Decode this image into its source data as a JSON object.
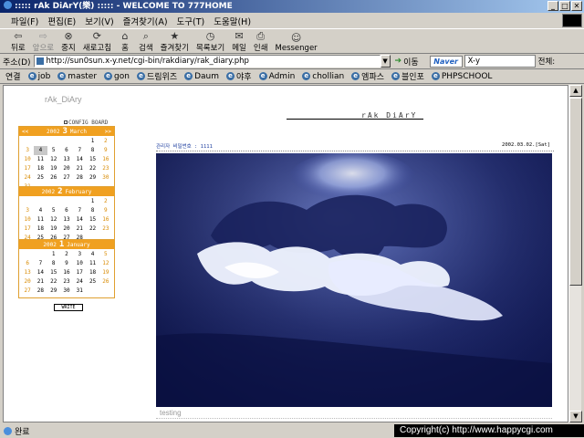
{
  "window": {
    "title": "::::: rAk DiArY(樂) ::::: - WELCOME TO 777HOME",
    "buttons": [
      "_",
      "□",
      "✕"
    ]
  },
  "menu": [
    "파일(F)",
    "편집(E)",
    "보기(V)",
    "즐겨찾기(A)",
    "도구(T)",
    "도움말(H)"
  ],
  "toolbar": [
    {
      "label": "뒤로",
      "icon": "back-arrow-icon",
      "glyph": "⇦",
      "disabled": false
    },
    {
      "label": "앞으로",
      "icon": "forward-arrow-icon",
      "glyph": "⇨",
      "disabled": true
    },
    {
      "label": "중지",
      "icon": "stop-icon",
      "glyph": "⊗",
      "disabled": false
    },
    {
      "label": "새로고침",
      "icon": "refresh-icon",
      "glyph": "⟳",
      "disabled": false
    },
    {
      "label": "홈",
      "icon": "home-icon",
      "glyph": "⌂",
      "disabled": false
    },
    {
      "label": "검색",
      "icon": "search-icon",
      "glyph": "⌕",
      "disabled": false
    },
    {
      "label": "즐겨찾기",
      "icon": "favorites-icon",
      "glyph": "★",
      "disabled": false
    },
    {
      "label": "목록보기",
      "icon": "history-icon",
      "glyph": "◷",
      "disabled": false
    },
    {
      "label": "메일",
      "icon": "mail-icon",
      "glyph": "✉",
      "disabled": false
    },
    {
      "label": "인쇄",
      "icon": "print-icon",
      "glyph": "⎙",
      "disabled": false
    },
    {
      "label": "Messenger",
      "icon": "messenger-icon",
      "glyph": "☺",
      "disabled": false
    }
  ],
  "address": {
    "label": "주소(D)",
    "url": "http://sun0sun.x-y.net/cgi-bin/rakdiary/rak_diary.php",
    "go": "이동",
    "naver": "Naver",
    "search_value": "X-y",
    "search_all": "전체:"
  },
  "links": {
    "label": "연결",
    "items": [
      "job",
      "master",
      "gon",
      "드림위즈",
      "Daum",
      "야후",
      "Admin",
      "chollian",
      "엠파스",
      "블인포",
      "PHPSCHOOL"
    ]
  },
  "page": {
    "brand": "rAk_DiAry",
    "title": "rAk DiArY",
    "config": "CONFIG BOARD",
    "write": "WRITE",
    "admin_pw": "관리자 비밀번호 : 1111",
    "date": "2002.03.02.[Sat]",
    "caption": "testing"
  },
  "calendars": [
    {
      "year": "2002",
      "month_num": "3",
      "month_name": "March",
      "prev": "<<",
      "next": ">>",
      "days": [
        "",
        "",
        "",
        "",
        "",
        "1",
        "2",
        "3",
        "4",
        "5",
        "6",
        "7",
        "8",
        "9",
        "10",
        "11",
        "12",
        "13",
        "14",
        "15",
        "16",
        "17",
        "18",
        "19",
        "20",
        "21",
        "22",
        "23",
        "24",
        "25",
        "26",
        "27",
        "28",
        "29",
        "30",
        "31"
      ],
      "today": "4"
    },
    {
      "year": "2002",
      "month_num": "2",
      "month_name": "February",
      "prev": "",
      "next": "",
      "days": [
        "",
        "",
        "",
        "",
        "",
        "1",
        "2",
        "3",
        "4",
        "5",
        "6",
        "7",
        "8",
        "9",
        "10",
        "11",
        "12",
        "13",
        "14",
        "15",
        "16",
        "17",
        "18",
        "19",
        "20",
        "21",
        "22",
        "23",
        "24",
        "25",
        "26",
        "27",
        "28"
      ],
      "today": ""
    },
    {
      "year": "2002",
      "month_num": "1",
      "month_name": "January",
      "prev": "",
      "next": "",
      "days": [
        "",
        "",
        "1",
        "2",
        "3",
        "4",
        "5",
        "6",
        "7",
        "8",
        "9",
        "10",
        "11",
        "12",
        "13",
        "14",
        "15",
        "16",
        "17",
        "18",
        "19",
        "20",
        "21",
        "22",
        "23",
        "24",
        "25",
        "26",
        "27",
        "28",
        "29",
        "30",
        "31"
      ],
      "today": ""
    }
  ],
  "status": {
    "text": "완료",
    "copyright": "Copyright(c) http://www.happycgi.com"
  }
}
